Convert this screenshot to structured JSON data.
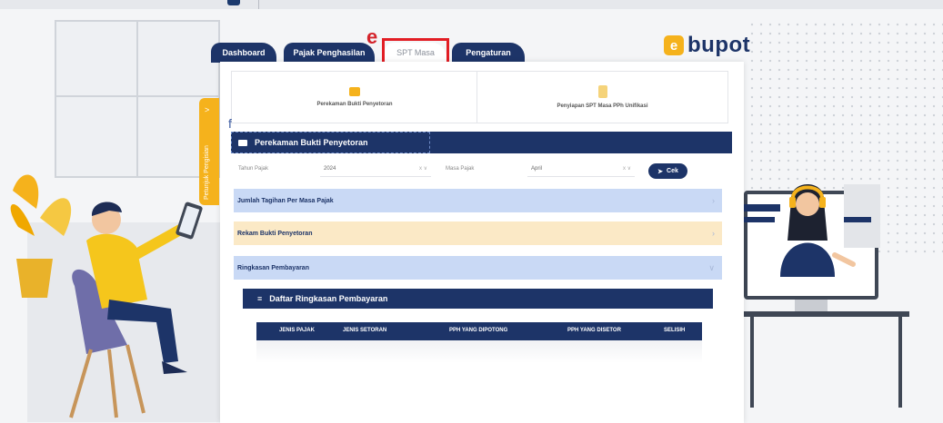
{
  "tabs": [
    {
      "label": "Dashboard",
      "active": false
    },
    {
      "label": "Pajak Penghasilan",
      "active": false
    },
    {
      "label": "SPT Masa",
      "active": true
    },
    {
      "label": "Pengaturan",
      "active": false
    }
  ],
  "annotations": {
    "e": "e",
    "f": "f"
  },
  "logo": {
    "mark": "e",
    "text": "bupot"
  },
  "side_tab": {
    "label": "Petunjuk Pengisian",
    "arrow": ">"
  },
  "menu_cards": [
    {
      "label": "Perekaman Bukti Penyetoran",
      "icon": "money-icon",
      "icon_color": "#f5b21c"
    },
    {
      "label": "Penyiapan SPT Masa PPh Unifikasi",
      "icon": "clipboard-icon",
      "icon_color": "#f5d37a"
    }
  ],
  "section": {
    "title": "Perekaman Bukti Penyetoran",
    "icon": "money-icon"
  },
  "filters": {
    "tahun_label": "Tahun Pajak",
    "tahun_value": "2024",
    "masa_label": "Masa Pajak",
    "masa_value": "April",
    "select_controls": "x ∨",
    "cek_label": "Cek"
  },
  "accordions": [
    {
      "label": "Jumlah Tagihan Per Masa Pajak",
      "chevron": "›",
      "bg": "#c9d9f5"
    },
    {
      "label": "Rekam Bukti Penyetoran",
      "chevron": "›",
      "bg": "#fbe9c6"
    },
    {
      "label": "Ringkasan Pembayaran",
      "chevron": "∨",
      "bg": "#c9d9f5"
    }
  ],
  "summary": {
    "title": "Daftar Ringkasan Pembayaran",
    "columns": [
      "JENIS PAJAK",
      "JENIS SETORAN",
      "PPH YANG DIPOTONG",
      "PPH YANG DISETOR",
      "SELISIH"
    ]
  },
  "colors": {
    "navy": "#1d3468",
    "accent": "#f5b21c",
    "highlight": "#e21d24"
  }
}
